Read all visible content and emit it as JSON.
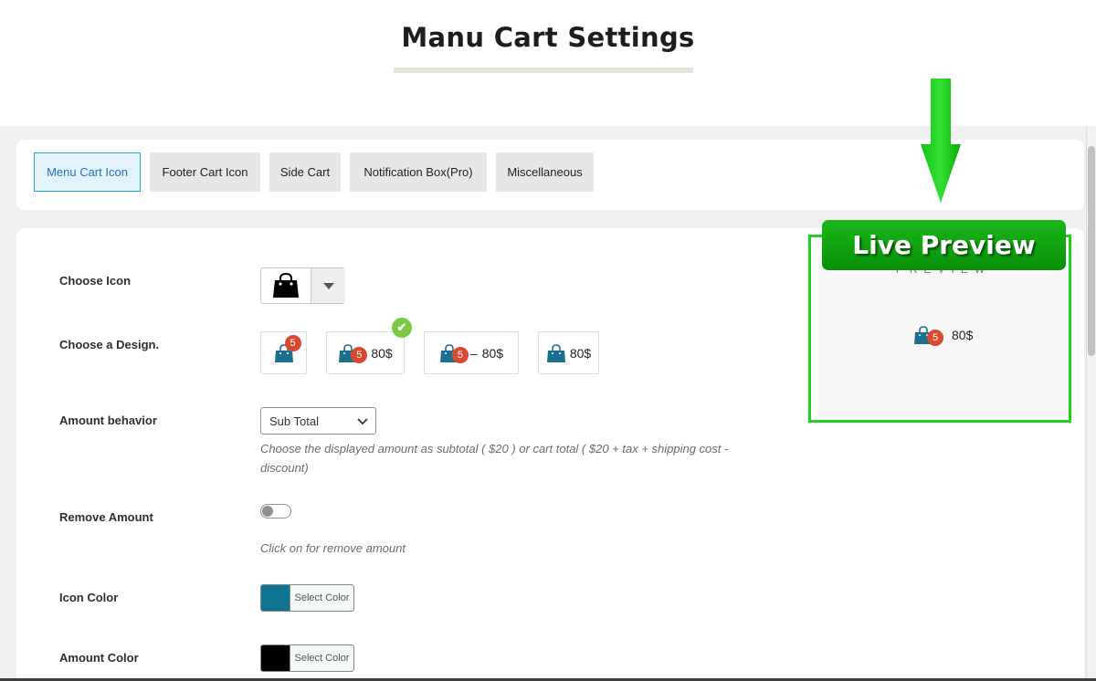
{
  "page": {
    "title": "Manu Cart Settings"
  },
  "tabs": [
    {
      "label": "Menu Cart Icon",
      "active": true
    },
    {
      "label": "Footer Cart Icon",
      "active": false
    },
    {
      "label": "Side Cart",
      "active": false
    },
    {
      "label": "Notification Box(Pro)",
      "active": false
    },
    {
      "label": "Miscellaneous",
      "active": false
    }
  ],
  "settings": {
    "choose_icon": {
      "label": "Choose Icon",
      "selected_icon": "shopping-bag-icon"
    },
    "choose_design": {
      "label": "Choose a Design.",
      "selected_index": 1,
      "options": [
        {
          "badge": "5",
          "amount": ""
        },
        {
          "badge": "5",
          "amount": "80$"
        },
        {
          "badge": "5",
          "separator": "–",
          "amount": "80$"
        },
        {
          "badge": "",
          "amount": "80$"
        }
      ]
    },
    "amount_behavior": {
      "label": "Amount behavior",
      "value": "Sub Total",
      "help": "Choose the displayed amount as subtotal ( $20 ) or cart total ( $20 + tax + shipping cost - discount)"
    },
    "remove_amount": {
      "label": "Remove Amount",
      "enabled": false,
      "help": "Click on for remove amount"
    },
    "icon_color": {
      "label": "Icon Color",
      "color": "#0e7490",
      "button": "Select Color"
    },
    "amount_color": {
      "label": "Amount Color",
      "color": "#000000",
      "button": "Select Color"
    }
  },
  "preview": {
    "heading": "PREVIEW",
    "badge": "5",
    "amount": "80$",
    "live_label": "Live Preview"
  },
  "colors": {
    "accent_blue": "#2a9fd8",
    "bag_color": "#1b7090",
    "badge_red": "#d84a2f",
    "highlight_green": "#1ed11e"
  }
}
